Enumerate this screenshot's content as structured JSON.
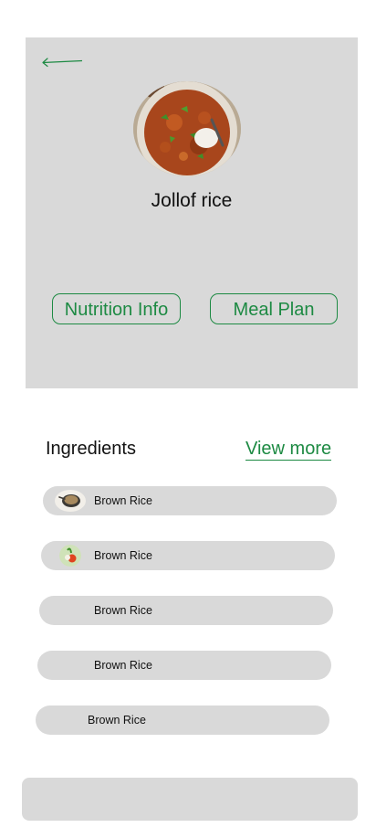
{
  "header": {
    "back_icon": "arrow-left-icon",
    "dish_name": "Jollof rice",
    "dish_image": "jollof-rice-bowl-photo"
  },
  "actions": {
    "nutrition_label": "Nutrition Info",
    "meal_plan_label": "Meal Plan"
  },
  "ingredients": {
    "heading": "Ingredients",
    "view_more_label": "View more",
    "items": [
      {
        "label": "Brown Rice",
        "thumb": "brown-rice-bowl-image"
      },
      {
        "label": "Brown Rice",
        "thumb": "vegetable-image"
      },
      {
        "label": "Brown Rice",
        "thumb": ""
      },
      {
        "label": "Brown Rice",
        "thumb": ""
      },
      {
        "label": "Brown Rice",
        "thumb": ""
      }
    ]
  },
  "colors": {
    "accent": "#1d8a43",
    "panel": "#d9d9d9",
    "text": "#111111"
  }
}
